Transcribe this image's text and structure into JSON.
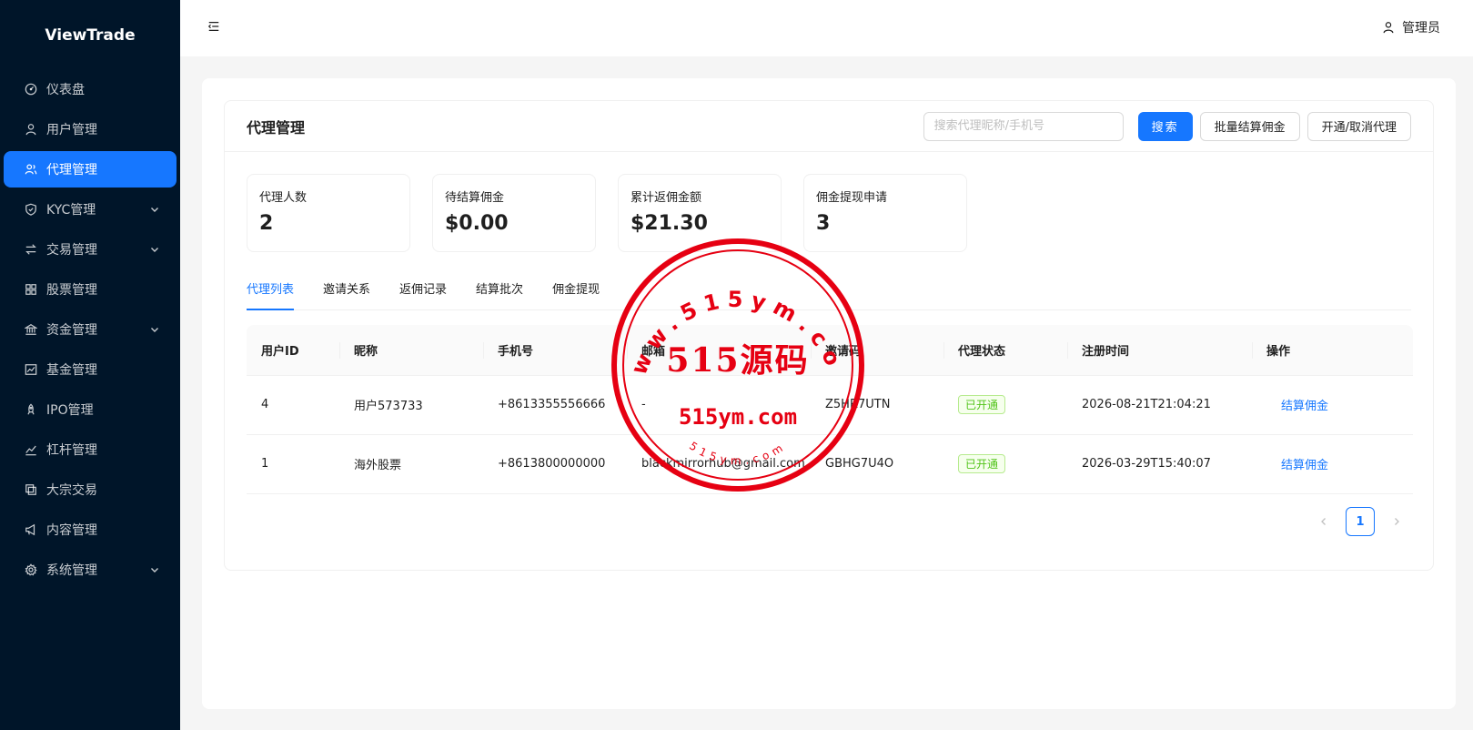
{
  "brand": "ViewTrade",
  "sidebar": {
    "items": [
      {
        "label": "仪表盘",
        "icon": "dashboard-icon",
        "active": false,
        "expandable": false
      },
      {
        "label": "用户管理",
        "icon": "user-icon",
        "active": false,
        "expandable": false
      },
      {
        "label": "代理管理",
        "icon": "agent-icon",
        "active": true,
        "expandable": false
      },
      {
        "label": "KYC管理",
        "icon": "shield-check-icon",
        "active": false,
        "expandable": true
      },
      {
        "label": "交易管理",
        "icon": "swap-icon",
        "active": false,
        "expandable": true
      },
      {
        "label": "股票管理",
        "icon": "grid-icon",
        "active": false,
        "expandable": false
      },
      {
        "label": "资金管理",
        "icon": "bank-icon",
        "active": false,
        "expandable": true
      },
      {
        "label": "基金管理",
        "icon": "chart-icon",
        "active": false,
        "expandable": false
      },
      {
        "label": "IPO管理",
        "icon": "rocket-icon",
        "active": false,
        "expandable": false
      },
      {
        "label": "杠杆管理",
        "icon": "stock-icon",
        "active": false,
        "expandable": false
      },
      {
        "label": "大宗交易",
        "icon": "block-icon",
        "active": false,
        "expandable": false
      },
      {
        "label": "内容管理",
        "icon": "sound-icon",
        "active": false,
        "expandable": false
      },
      {
        "label": "系统管理",
        "icon": "setting-icon",
        "active": false,
        "expandable": true
      }
    ]
  },
  "header": {
    "user_label": "管理员"
  },
  "page": {
    "title": "代理管理",
    "search_placeholder": "搜索代理昵称/手机号",
    "search_button": "搜索",
    "batch_button": "批量结算佣金",
    "toggle_button": "开通/取消代理"
  },
  "stats": [
    {
      "label": "代理人数",
      "value": "2"
    },
    {
      "label": "待结算佣金",
      "value": "$0.00"
    },
    {
      "label": "累计返佣金额",
      "value": "$21.30"
    },
    {
      "label": "佣金提现申请",
      "value": "3"
    }
  ],
  "tabs": [
    {
      "label": "代理列表",
      "active": true
    },
    {
      "label": "邀请关系",
      "active": false
    },
    {
      "label": "返佣记录",
      "active": false
    },
    {
      "label": "结算批次",
      "active": false
    },
    {
      "label": "佣金提现",
      "active": false
    }
  ],
  "table": {
    "columns": [
      "用户ID",
      "昵称",
      "手机号",
      "邮箱",
      "邀请码",
      "代理状态",
      "注册时间",
      "操作"
    ],
    "rows": [
      {
        "id": "4",
        "nickname": "用户573733",
        "phone": "+8613355556666",
        "email": "-",
        "invite_code": "Z5HR7UTN",
        "status": "已开通",
        "registered": "2026-08-21T21:04:21",
        "action": "结算佣金"
      },
      {
        "id": "1",
        "nickname": "海外股票",
        "phone": "+8613800000000",
        "email": "blackmirrorhub@gmail.com",
        "invite_code": "GBHG7U4O",
        "status": "已开通",
        "registered": "2026-03-29T15:40:07",
        "action": "结算佣金"
      }
    ]
  },
  "pagination": {
    "current": "1"
  },
  "watermark": {
    "main": "515源码",
    "url": "515ym.com",
    "ring_top": "www.515ym.com",
    "ring_bottom": "515ym.com",
    "color": "#e60012"
  },
  "colors": {
    "sidebar_bg": "#001529",
    "primary": "#1677ff",
    "success": "#52c41a"
  }
}
